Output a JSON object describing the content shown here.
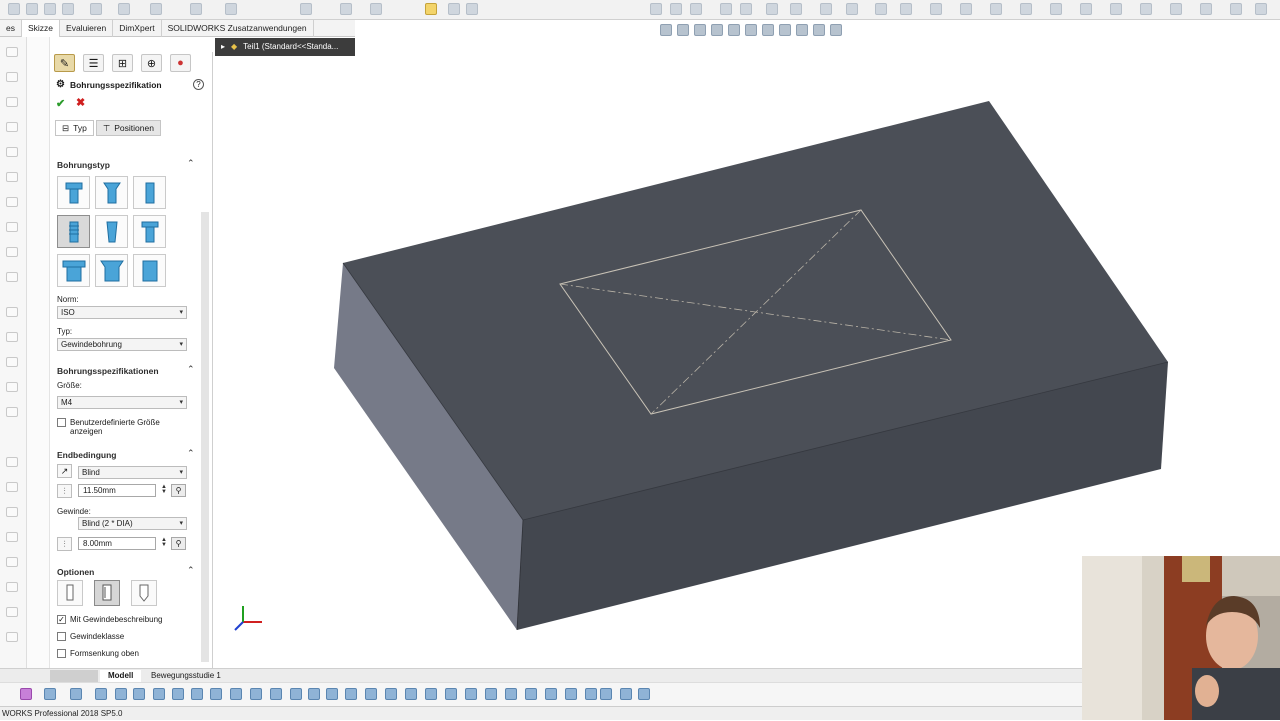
{
  "ribbon": {
    "tabs": [
      "es",
      "Skizze",
      "Evaluieren",
      "DimXpert",
      "SOLIDWORKS Zusatzanwendungen"
    ],
    "active_tab": "Skizze"
  },
  "tree_flyout": {
    "label": "Teil1  (Standard<<Standa..."
  },
  "property_manager": {
    "title": "Bohrungsspezifikation",
    "help": "?",
    "ok": "✔",
    "cancel": "✖",
    "tab_type": "Typ",
    "tab_positions": "Positionen",
    "section_hole_type": "Bohrungstyp",
    "norm_label": "Norm:",
    "norm_value": "ISO",
    "type_label": "Typ:",
    "type_value": "Gewindebohrung",
    "section_hole_specs": "Bohrungsspezifikationen",
    "size_label": "Größe:",
    "size_value": "M4",
    "custom_size_label": "Benutzerdefinierte Größe anzeigen",
    "section_end_condition": "Endbedingung",
    "end_condition_value": "Blind",
    "depth_value": "11.50mm",
    "thread_label": "Gewinde:",
    "thread_condition_value": "Blind (2 * DIA)",
    "thread_depth_value": "8.00mm",
    "section_options": "Optionen",
    "opt_cosmetic_thread": "Mit Gewindebeschreibung",
    "opt_cosmetic_thread_checked": true,
    "opt_thread_class": "Gewindeklasse",
    "opt_thread_class_checked": false,
    "opt_near_side_countersink": "Formsenkung oben",
    "opt_near_side_countersink_checked": false
  },
  "bottom_tabs": {
    "model": "Modell",
    "motion": "Bewegungsstudie 1"
  },
  "statusbar": {
    "text": "WORKS Professional 2018 SP5.0"
  },
  "colors": {
    "part_top": "#4b4f57",
    "part_front": "#43474f",
    "part_left": "#767a88",
    "sketch_line": "#c8c2b6",
    "accent": "#2c9c2c"
  }
}
